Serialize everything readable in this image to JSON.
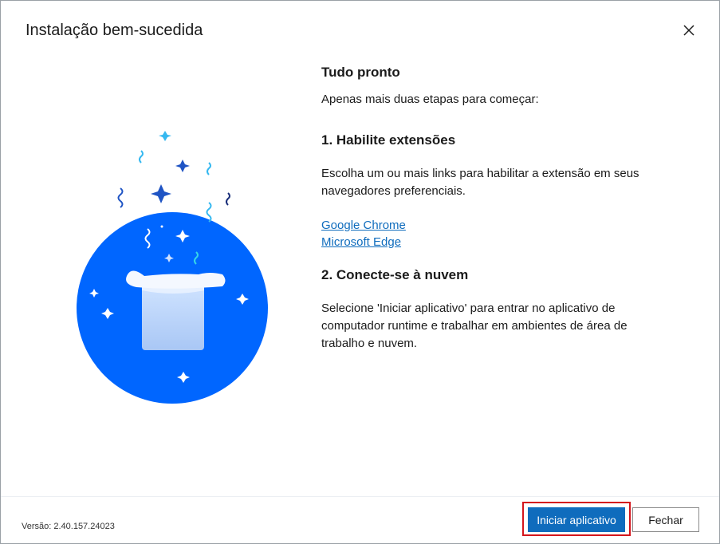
{
  "dialog": {
    "title": "Instalação bem-sucedida",
    "close_icon": "close-icon"
  },
  "content": {
    "heading": "Tudo pronto",
    "intro": "Apenas mais duas etapas para começar:",
    "step1": {
      "heading": "1. Habilite extensões",
      "text": "Escolha um ou mais links para habilitar a extensão em seus navegadores preferenciais.",
      "links": [
        "Google Chrome",
        "Microsoft Edge"
      ]
    },
    "step2": {
      "heading": "2. Conecte-se à nuvem",
      "text": "Selecione 'Iniciar aplicativo' para entrar no aplicativo de computador runtime e trabalhar em ambientes de área de trabalho e nuvem."
    }
  },
  "footer": {
    "version": "Versão: 2.40.157.24023",
    "primary_label": "Iniciar aplicativo",
    "secondary_label": "Fechar"
  },
  "colors": {
    "accent": "#0f6cbd",
    "circle": "#0066ff",
    "focus_ring": "#d4151c"
  }
}
